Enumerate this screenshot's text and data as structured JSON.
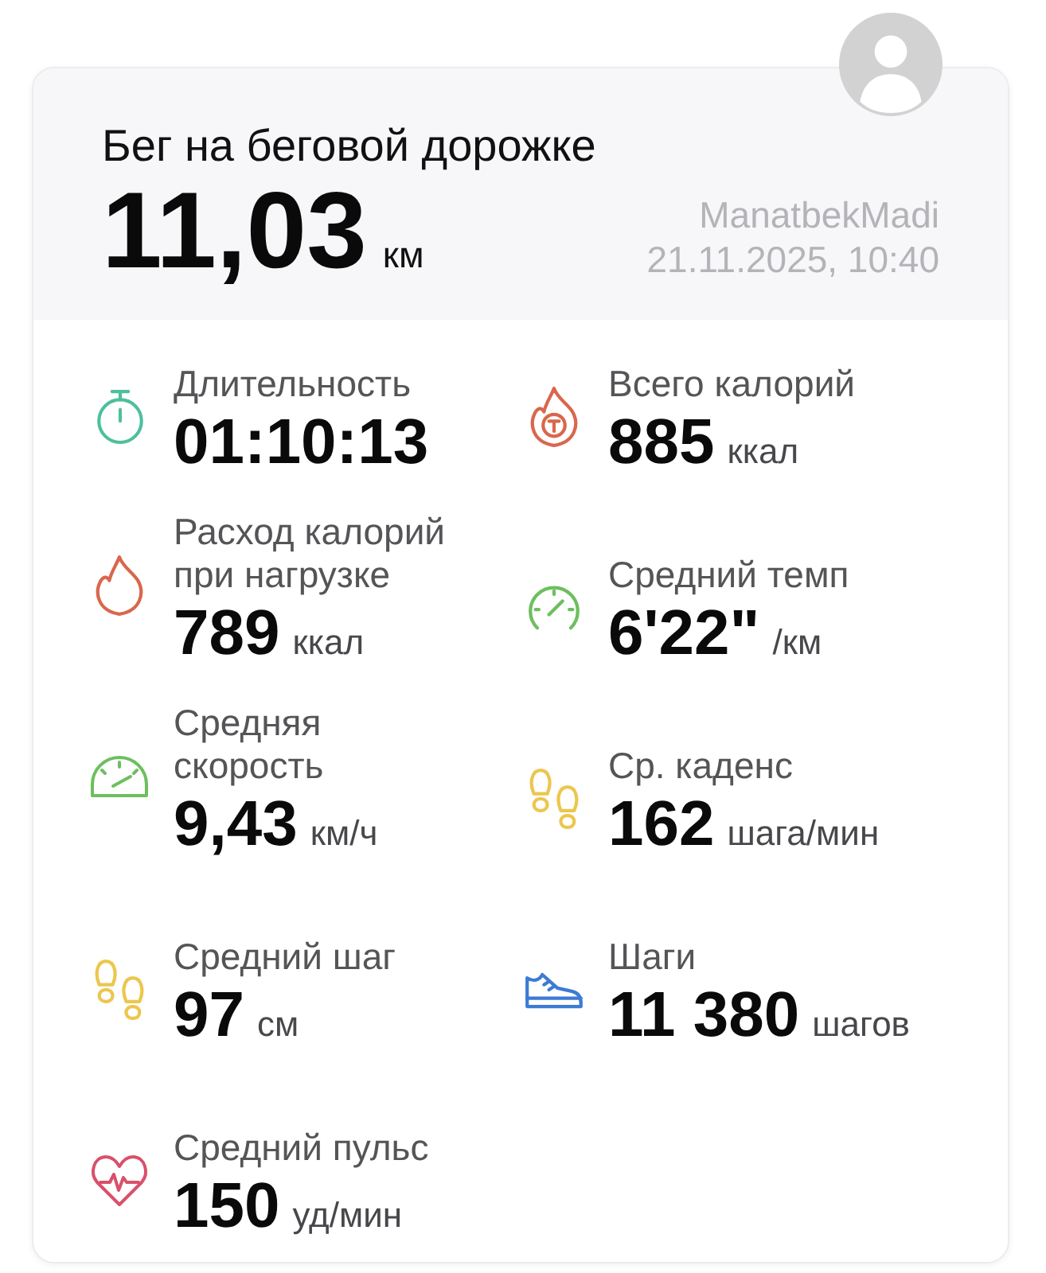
{
  "workout": {
    "title": "Бег на беговой дорожке",
    "distance": "11,03",
    "distance_unit": "км",
    "user": "ManatbekMadi",
    "datetime": "21.11.2025, 10:40"
  },
  "stats": [
    {
      "kind": "stopwatch",
      "color": "#4dbf9c",
      "label": "Длительность",
      "value": "01:10:13"
    },
    {
      "kind": "calorie-total",
      "color": "#d9674c",
      "label": "Всего калорий",
      "value": "885",
      "unit": "ккал"
    },
    {
      "kind": "flame",
      "color": "#d9674c",
      "label": "Расход калорий при нагрузке",
      "value": "789",
      "unit": "ккал"
    },
    {
      "kind": "pace-gauge",
      "color": "#6cbf5e",
      "label": "Средний темп",
      "value": "6'22\"",
      "unit": "/км"
    },
    {
      "kind": "speedometer",
      "color": "#6cbf5e",
      "label": "Средняя скорость",
      "value": "9,43",
      "unit": "км/ч"
    },
    {
      "kind": "footprints",
      "color": "#ecc64e",
      "label": "Ср. каденс",
      "value": "162",
      "unit": "шага/мин"
    },
    {
      "kind": "footprints",
      "color": "#ecc64e",
      "label": "Средний шаг",
      "value": "97",
      "unit": "см"
    },
    {
      "kind": "shoe",
      "color": "#3d7bd4",
      "label": "Шаги",
      "value": "11 380",
      "unit": "шагов"
    },
    {
      "kind": "heart",
      "color": "#d9506a",
      "label": "Средний пульс",
      "value": "150",
      "unit": "уд/мин"
    }
  ]
}
